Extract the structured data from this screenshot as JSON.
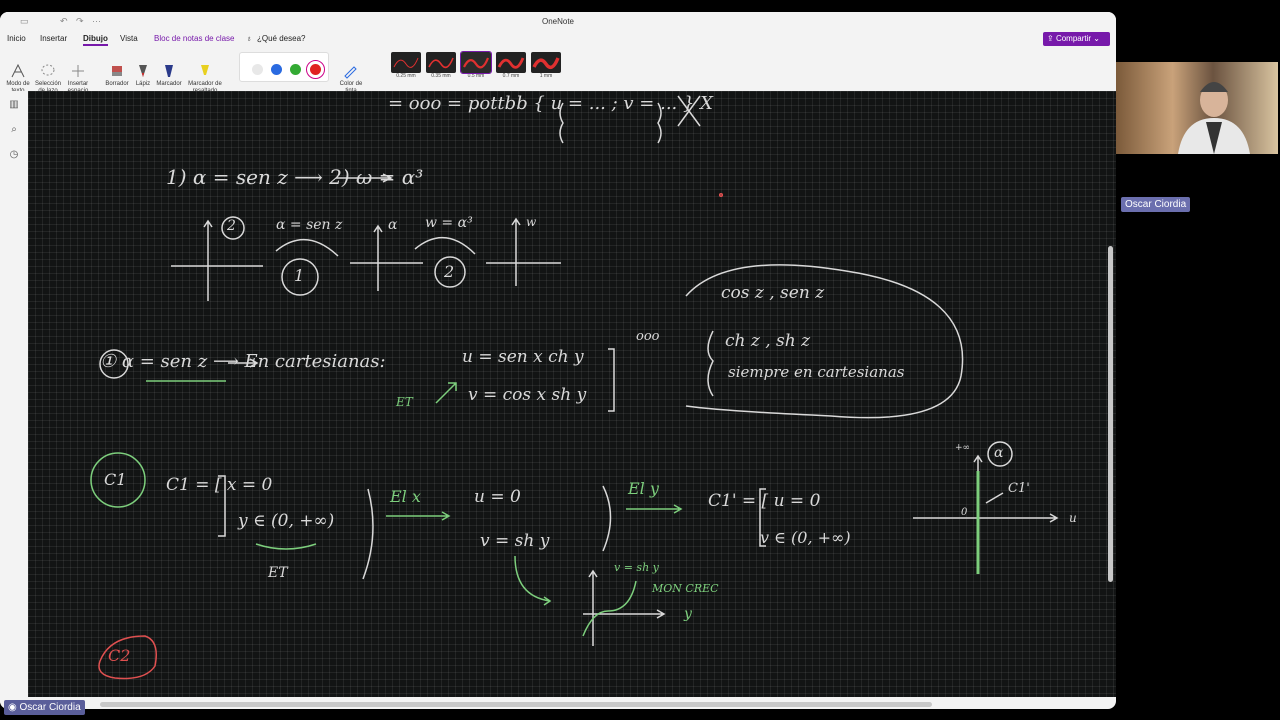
{
  "window": {
    "title": "OneNote"
  },
  "menu": [
    {
      "label": "Inicio"
    },
    {
      "label": "Insertar"
    },
    {
      "label": "Dibujo"
    },
    {
      "label": "Vista"
    },
    {
      "label": "Bloc de notas de clase"
    },
    {
      "label": "¿Qué desea?"
    }
  ],
  "share_label": "Compartir",
  "ribbon": {
    "modo_texto": "Modo de texto",
    "seleccion_lazo": "Selección de lazo",
    "insertar_espacio": "Insertar espacio",
    "borrador": "Borrador",
    "lapiz": "Lápiz",
    "marcador": "Marcador",
    "marcador_resaltado": "Marcador de resaltado",
    "color_tinta": "Color de tinta",
    "colors": [
      "#e8e8e8",
      "#2a6ae0",
      "#33aa33",
      "#e02020"
    ],
    "thickness": [
      "0.25 mm",
      "0.35 mm",
      "0.5 mm",
      "0.7 mm",
      "1 mm"
    ]
  },
  "notes": {
    "top_line": "= ooo = pottbb { u = ... ; v = ... } X",
    "step_line": "1)  α = sen z ⟶ 2) ω = α³",
    "circle1": "1",
    "circle2": "2",
    "map1": "α = sen z",
    "map2": "w = α³",
    "axis_alpha": "α",
    "axis_w": "w",
    "cloud1": "cos z , sen z",
    "cloud2": "ch z , sh z",
    "cloud3": "siempre en cartesianas",
    "cartesian": "① α = sen z ⟶ En cartesianas:",
    "u_eq": "u = sen x ch y",
    "v_eq": "v = cos x sh y",
    "et1": "ET",
    "dots": "ooo",
    "c1_label": "C1",
    "c1_def1": "C1 = [ x = 0",
    "c1_def2": "y ∈ (0, +∞)",
    "et2": "ET",
    "el_x": "El x",
    "u0": "u = 0",
    "v_shy": "v = sh y",
    "el_y": "El y",
    "c1p_def1": "C1' = [ u = 0",
    "c1p_def2": "v ∈ (0, +∞)",
    "graph_v": "v = sh y",
    "mon": "MON CREC",
    "graph_y": "y",
    "plane_v": "+∞",
    "plane_alpha": "α",
    "plane_c1": "C1'",
    "plane_u": "u",
    "plane_o": "0",
    "c2_label": "C2"
  },
  "participant": {
    "name": "Oscar Ciordia"
  }
}
